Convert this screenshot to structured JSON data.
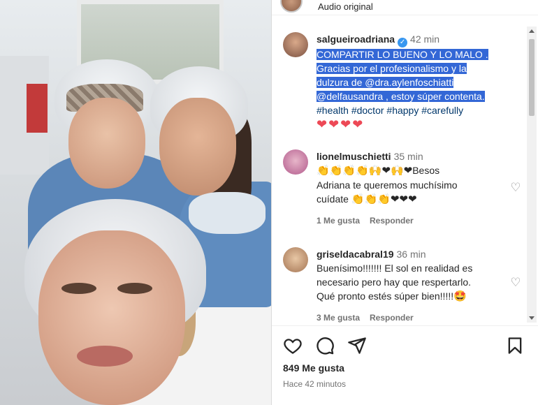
{
  "header": {
    "audio_label": "Audio original"
  },
  "caption": {
    "username": "salgueiroadriana",
    "time": "42 min",
    "line1": "COMPARTIR LO BUENO Y LO MALO .",
    "line2": "Gracias por el profesionalismo y la",
    "line3": "dulzura de @dra.aylenfoschiatti",
    "line4": "@delfausandra , estoy súper contenta.",
    "hashtags": "#health #doctor #happy #carefully",
    "hearts": "❤❤❤❤"
  },
  "comments": [
    {
      "username": "lionelmuschietti",
      "time": "35 min",
      "emoji_line": "👏👏👏👏🙌❤🙌❤",
      "text1": "Besos",
      "text2": "Adriana te queremos muchísimo",
      "text3": "cuídate",
      "emoji_end": "👏👏👏❤❤❤",
      "likes": "1 Me gusta",
      "reply": "Responder"
    },
    {
      "username": "griseldacabral19",
      "time": "36 min",
      "text1": "Buenísimo!!!!!!! El sol en realidad es",
      "text2": "necesario pero hay que respertarlo.",
      "text3": "Qué pronto estés súper bien!!!!!",
      "emoji_end": "🤩",
      "likes": "3 Me gusta",
      "reply": "Responder"
    }
  ],
  "footer": {
    "likes": "849 Me gusta",
    "ago": "Hace 42 minutos"
  },
  "icons": {
    "like": "heart-icon",
    "comment": "comment-icon",
    "share": "share-icon",
    "save": "bookmark-icon"
  }
}
